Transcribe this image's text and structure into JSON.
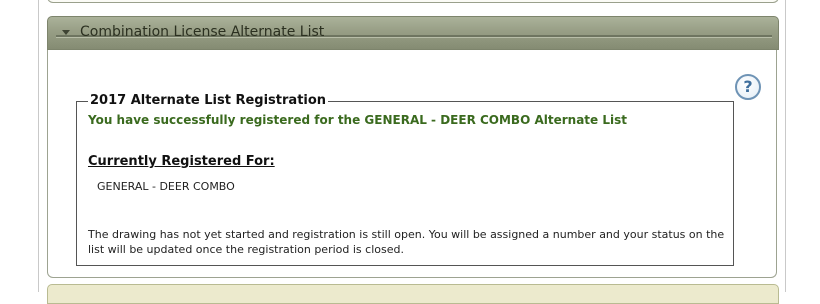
{
  "section": {
    "title": "Combination License Alternate List"
  },
  "help": {
    "icon_label": "?",
    "icon": "question-circle-icon"
  },
  "registration": {
    "legend": "2017 Alternate List Registration",
    "success_message": "You have successfully registered for the GENERAL - DEER COMBO Alternate List",
    "registered_heading": "Currently Registered For:",
    "registered_items": [
      "GENERAL - DEER COMBO"
    ],
    "info_text": "The drawing has not yet started and registration is still open. You will be assigned a number and your status on the list will be updated once the registration period is closed."
  },
  "colors": {
    "header_green": "#979e85",
    "success_green": "#3a6a1e",
    "help_blue": "#6e93b5",
    "next_panel": "#eceacd"
  }
}
